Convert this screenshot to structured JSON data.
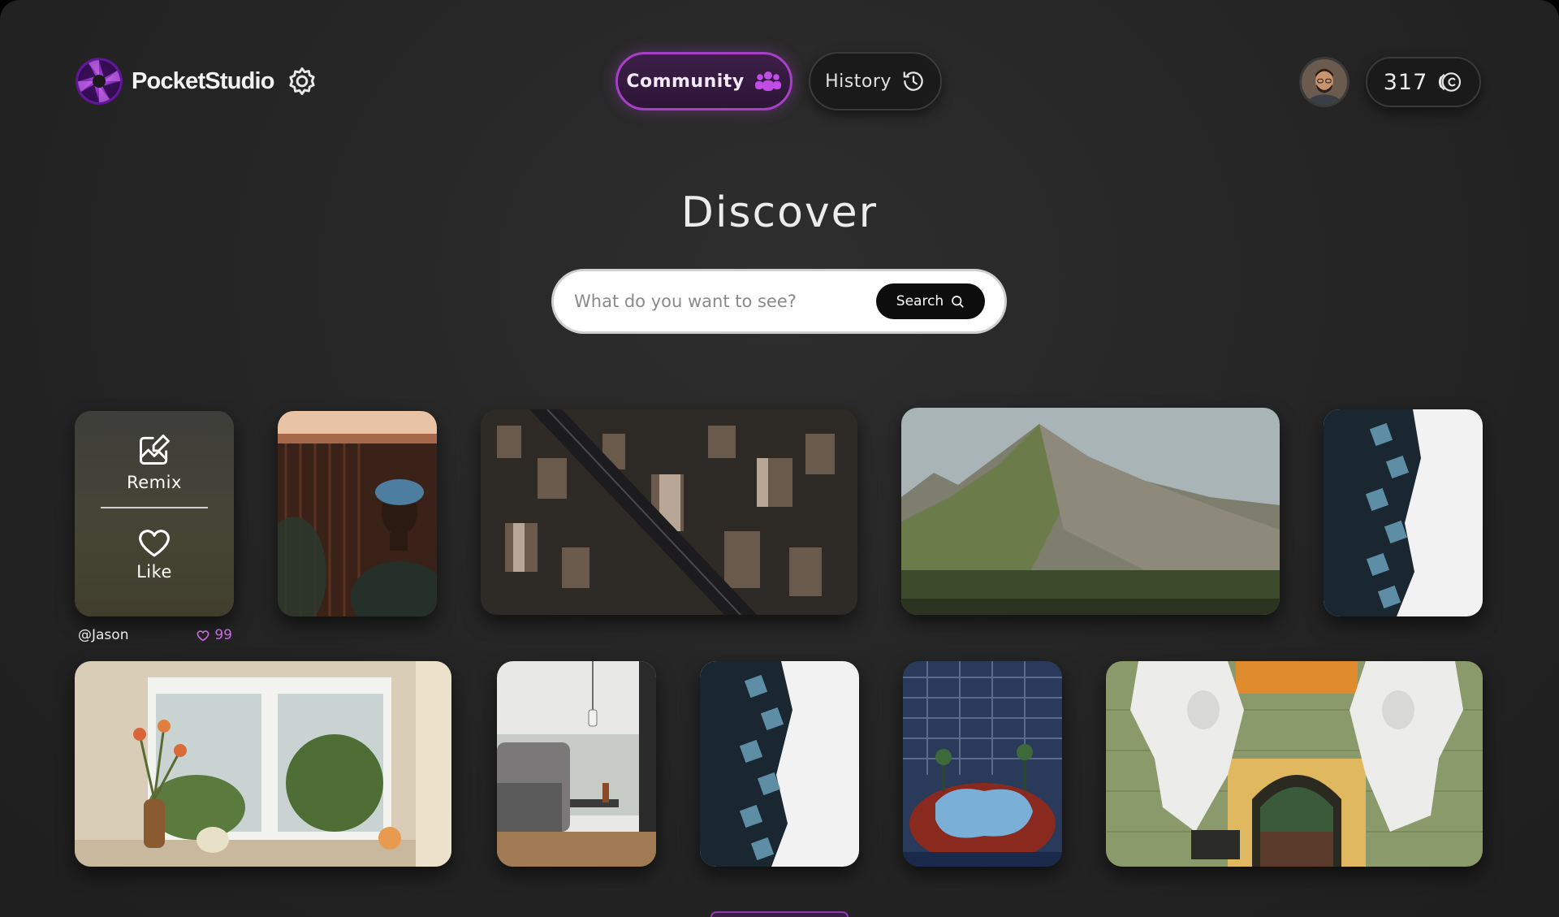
{
  "app": {
    "name": "PocketStudio"
  },
  "nav": {
    "community_label": "Community",
    "history_label": "History",
    "active": "Community"
  },
  "user": {
    "credits": "317"
  },
  "hero": {
    "title": "Discover",
    "search_placeholder": "What do you want to see?",
    "search_button_label": "Search"
  },
  "gallery": {
    "hovered_card": {
      "remix_label": "Remix",
      "like_label": "Like",
      "author": "@Jason",
      "likes": "99"
    }
  },
  "colors": {
    "accent": "#a740c7",
    "likes": "#c86ae6",
    "background": "#262626"
  },
  "icons": {
    "logo": "aperture-icon",
    "settings": "gear-icon",
    "community": "group-icon",
    "history": "history-icon",
    "credits": "coin-icon",
    "search": "search-icon",
    "remix": "edit-image-icon",
    "like": "heart-icon"
  }
}
